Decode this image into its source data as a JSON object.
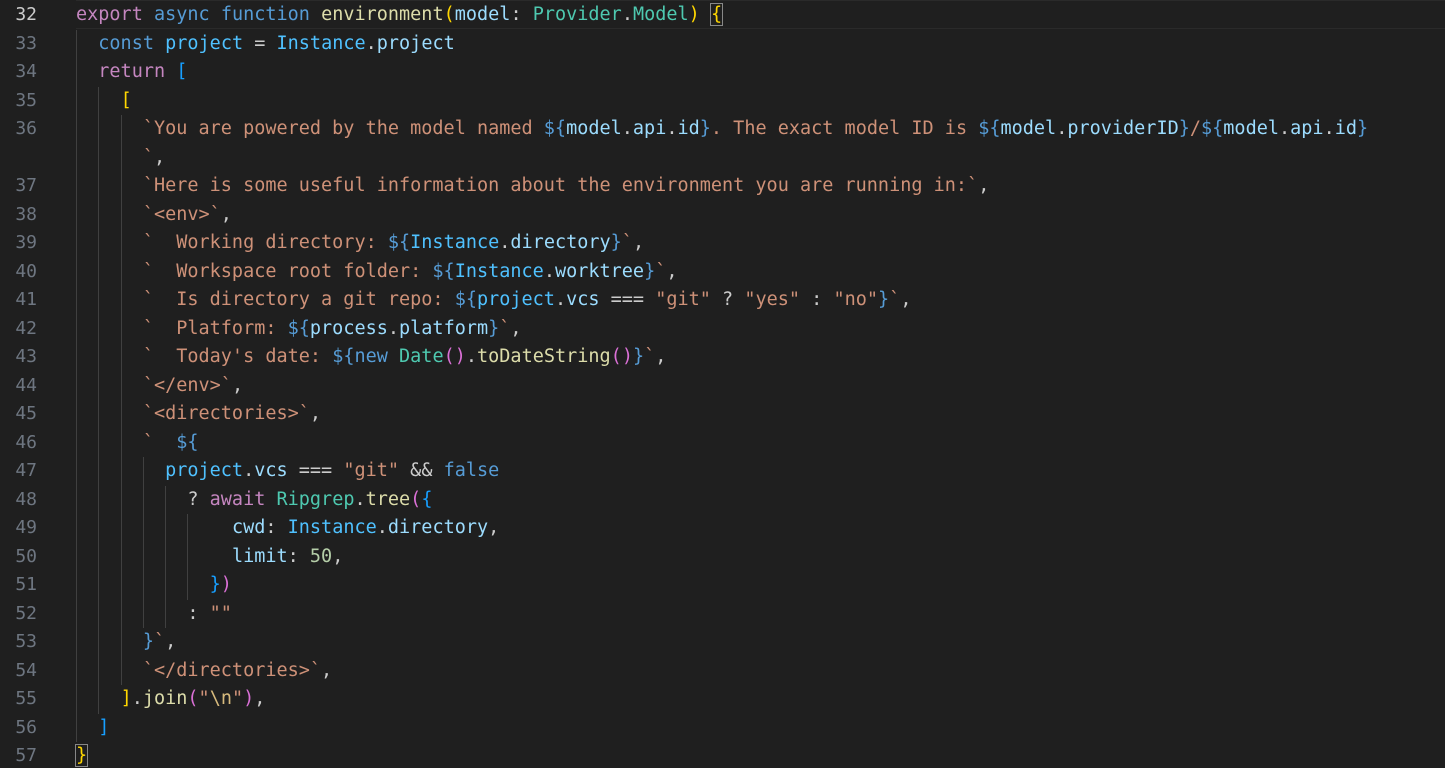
{
  "editor": {
    "language": "typescript",
    "active_line": "32",
    "lines": [
      {
        "n": "32",
        "tokens": [
          {
            "t": "export",
            "c": "ctl"
          },
          {
            "t": " "
          },
          {
            "t": "async",
            "c": "kw"
          },
          {
            "t": " "
          },
          {
            "t": "function",
            "c": "kw"
          },
          {
            "t": " "
          },
          {
            "t": "environment",
            "c": "fn"
          },
          {
            "t": "(",
            "c": "b1"
          },
          {
            "t": "model",
            "c": "var"
          },
          {
            "t": ": "
          },
          {
            "t": "Provider",
            "c": "typ"
          },
          {
            "t": "."
          },
          {
            "t": "Model",
            "c": "typ"
          },
          {
            "t": ")",
            "c": "b1"
          },
          {
            "t": " "
          },
          {
            "t": "{",
            "c": "b1",
            "box": true
          }
        ]
      },
      {
        "n": "33",
        "tokens": [
          {
            "t": "  "
          },
          {
            "t": "const",
            "c": "kw"
          },
          {
            "t": " "
          },
          {
            "t": "project",
            "c": "cst"
          },
          {
            "t": " = "
          },
          {
            "t": "Instance",
            "c": "cst"
          },
          {
            "t": "."
          },
          {
            "t": "project",
            "c": "var"
          }
        ]
      },
      {
        "n": "34",
        "tokens": [
          {
            "t": "  "
          },
          {
            "t": "return",
            "c": "ctl"
          },
          {
            "t": " "
          },
          {
            "t": "[",
            "c": "b3"
          }
        ]
      },
      {
        "n": "35",
        "tokens": [
          {
            "t": "    "
          },
          {
            "t": "[",
            "c": "b1"
          }
        ]
      },
      {
        "n": "36",
        "tokens": [
          {
            "t": "      "
          },
          {
            "t": "`You are powered by the model named ",
            "c": "str"
          },
          {
            "t": "${",
            "c": "tpl"
          },
          {
            "t": "model",
            "c": "var"
          },
          {
            "t": "."
          },
          {
            "t": "api",
            "c": "var"
          },
          {
            "t": "."
          },
          {
            "t": "id",
            "c": "var"
          },
          {
            "t": "}",
            "c": "tpl"
          },
          {
            "t": ". The exact model ID is ",
            "c": "str"
          },
          {
            "t": "${",
            "c": "tpl"
          },
          {
            "t": "model",
            "c": "var"
          },
          {
            "t": "."
          },
          {
            "t": "providerID",
            "c": "var"
          },
          {
            "t": "}",
            "c": "tpl"
          },
          {
            "t": "/",
            "c": "str"
          },
          {
            "t": "${",
            "c": "tpl"
          },
          {
            "t": "model",
            "c": "var"
          },
          {
            "t": "."
          },
          {
            "t": "api",
            "c": "var"
          },
          {
            "t": "."
          },
          {
            "t": "id",
            "c": "var"
          },
          {
            "t": "}",
            "c": "tpl"
          }
        ]
      },
      {
        "n": "",
        "tokens": [
          {
            "t": "      "
          },
          {
            "t": "`",
            "c": "str"
          },
          {
            "t": ","
          }
        ]
      },
      {
        "n": "37",
        "tokens": [
          {
            "t": "      "
          },
          {
            "t": "`Here is some useful information about the environment you are running in:`",
            "c": "str"
          },
          {
            "t": ","
          }
        ]
      },
      {
        "n": "38",
        "tokens": [
          {
            "t": "      "
          },
          {
            "t": "`<env>`",
            "c": "str"
          },
          {
            "t": ","
          }
        ]
      },
      {
        "n": "39",
        "tokens": [
          {
            "t": "      "
          },
          {
            "t": "`  Working directory: ",
            "c": "str"
          },
          {
            "t": "${",
            "c": "tpl"
          },
          {
            "t": "Instance",
            "c": "cst"
          },
          {
            "t": "."
          },
          {
            "t": "directory",
            "c": "var"
          },
          {
            "t": "}",
            "c": "tpl"
          },
          {
            "t": "`",
            "c": "str"
          },
          {
            "t": ","
          }
        ]
      },
      {
        "n": "40",
        "tokens": [
          {
            "t": "      "
          },
          {
            "t": "`  Workspace root folder: ",
            "c": "str"
          },
          {
            "t": "${",
            "c": "tpl"
          },
          {
            "t": "Instance",
            "c": "cst"
          },
          {
            "t": "."
          },
          {
            "t": "worktree",
            "c": "var"
          },
          {
            "t": "}",
            "c": "tpl"
          },
          {
            "t": "`",
            "c": "str"
          },
          {
            "t": ","
          }
        ]
      },
      {
        "n": "41",
        "tokens": [
          {
            "t": "      "
          },
          {
            "t": "`  Is directory a git repo: ",
            "c": "str"
          },
          {
            "t": "${",
            "c": "tpl"
          },
          {
            "t": "project",
            "c": "cst"
          },
          {
            "t": "."
          },
          {
            "t": "vcs",
            "c": "var"
          },
          {
            "t": " === "
          },
          {
            "t": "\"git\"",
            "c": "str"
          },
          {
            "t": " ? "
          },
          {
            "t": "\"yes\"",
            "c": "str"
          },
          {
            "t": " : "
          },
          {
            "t": "\"no\"",
            "c": "str"
          },
          {
            "t": "}",
            "c": "tpl"
          },
          {
            "t": "`",
            "c": "str"
          },
          {
            "t": ","
          }
        ]
      },
      {
        "n": "42",
        "tokens": [
          {
            "t": "      "
          },
          {
            "t": "`  Platform: ",
            "c": "str"
          },
          {
            "t": "${",
            "c": "tpl"
          },
          {
            "t": "process",
            "c": "var"
          },
          {
            "t": "."
          },
          {
            "t": "platform",
            "c": "var"
          },
          {
            "t": "}",
            "c": "tpl"
          },
          {
            "t": "`",
            "c": "str"
          },
          {
            "t": ","
          }
        ]
      },
      {
        "n": "43",
        "tokens": [
          {
            "t": "      "
          },
          {
            "t": "`  Today's date: ",
            "c": "str"
          },
          {
            "t": "${",
            "c": "tpl"
          },
          {
            "t": "new",
            "c": "kw"
          },
          {
            "t": " "
          },
          {
            "t": "Date",
            "c": "typ"
          },
          {
            "t": "(",
            "c": "b2"
          },
          {
            "t": ")",
            "c": "b2"
          },
          {
            "t": "."
          },
          {
            "t": "toDateString",
            "c": "fn"
          },
          {
            "t": "(",
            "c": "b2"
          },
          {
            "t": ")",
            "c": "b2"
          },
          {
            "t": "}",
            "c": "tpl"
          },
          {
            "t": "`",
            "c": "str"
          },
          {
            "t": ","
          }
        ]
      },
      {
        "n": "44",
        "tokens": [
          {
            "t": "      "
          },
          {
            "t": "`</env>`",
            "c": "str"
          },
          {
            "t": ","
          }
        ]
      },
      {
        "n": "45",
        "tokens": [
          {
            "t": "      "
          },
          {
            "t": "`<directories>`",
            "c": "str"
          },
          {
            "t": ","
          }
        ]
      },
      {
        "n": "46",
        "tokens": [
          {
            "t": "      "
          },
          {
            "t": "`  ",
            "c": "str"
          },
          {
            "t": "${",
            "c": "tpl"
          }
        ]
      },
      {
        "n": "47",
        "tokens": [
          {
            "t": "        "
          },
          {
            "t": "project",
            "c": "cst"
          },
          {
            "t": "."
          },
          {
            "t": "vcs",
            "c": "var"
          },
          {
            "t": " === "
          },
          {
            "t": "\"git\"",
            "c": "str"
          },
          {
            "t": " && "
          },
          {
            "t": "false",
            "c": "kw"
          }
        ]
      },
      {
        "n": "48",
        "tokens": [
          {
            "t": "          ? "
          },
          {
            "t": "await",
            "c": "ctl"
          },
          {
            "t": " "
          },
          {
            "t": "Ripgrep",
            "c": "typ"
          },
          {
            "t": "."
          },
          {
            "t": "tree",
            "c": "fn"
          },
          {
            "t": "(",
            "c": "b2"
          },
          {
            "t": "{",
            "c": "b3"
          }
        ]
      },
      {
        "n": "49",
        "tokens": [
          {
            "t": "              "
          },
          {
            "t": "cwd",
            "c": "var"
          },
          {
            "t": ": "
          },
          {
            "t": "Instance",
            "c": "cst"
          },
          {
            "t": "."
          },
          {
            "t": "directory",
            "c": "var"
          },
          {
            "t": ","
          }
        ]
      },
      {
        "n": "50",
        "tokens": [
          {
            "t": "              "
          },
          {
            "t": "limit",
            "c": "var"
          },
          {
            "t": ": "
          },
          {
            "t": "50",
            "c": "num"
          },
          {
            "t": ","
          }
        ]
      },
      {
        "n": "51",
        "tokens": [
          {
            "t": "            "
          },
          {
            "t": "}",
            "c": "b3"
          },
          {
            "t": ")",
            "c": "b2"
          }
        ]
      },
      {
        "n": "52",
        "tokens": [
          {
            "t": "          : "
          },
          {
            "t": "\"\"",
            "c": "str"
          }
        ]
      },
      {
        "n": "53",
        "tokens": [
          {
            "t": "      "
          },
          {
            "t": "}",
            "c": "tpl"
          },
          {
            "t": "`",
            "c": "str"
          },
          {
            "t": ","
          }
        ]
      },
      {
        "n": "54",
        "tokens": [
          {
            "t": "      "
          },
          {
            "t": "`</directories>`",
            "c": "str"
          },
          {
            "t": ","
          }
        ]
      },
      {
        "n": "55",
        "tokens": [
          {
            "t": "    "
          },
          {
            "t": "]",
            "c": "b1"
          },
          {
            "t": "."
          },
          {
            "t": "join",
            "c": "fn"
          },
          {
            "t": "(",
            "c": "b2"
          },
          {
            "t": "\"",
            "c": "str"
          },
          {
            "t": "\\n",
            "c": "esc"
          },
          {
            "t": "\"",
            "c": "str"
          },
          {
            "t": ")",
            "c": "b2"
          },
          {
            "t": ","
          }
        ]
      },
      {
        "n": "56",
        "tokens": [
          {
            "t": "  "
          },
          {
            "t": "]",
            "c": "b3"
          }
        ]
      },
      {
        "n": "57",
        "tokens": [
          {
            "t": "}",
            "c": "b1",
            "box": true
          }
        ]
      }
    ]
  }
}
